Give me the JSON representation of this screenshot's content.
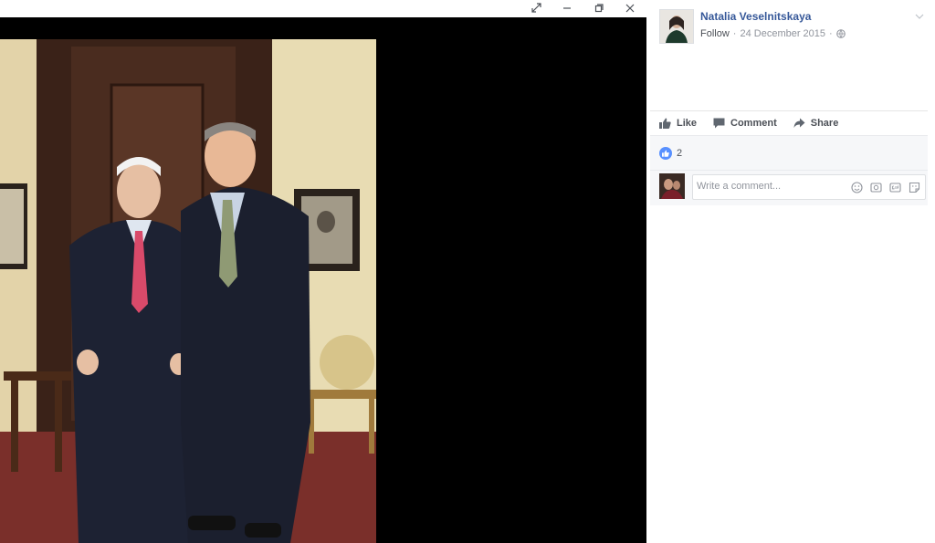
{
  "window": {
    "controls": [
      "expand-icon",
      "minimize-icon",
      "restore-icon",
      "close-icon"
    ]
  },
  "post": {
    "author": "Natalia Veselnitskaya",
    "follow_label": "Follow",
    "separator": "·",
    "date": "24 December 2015",
    "privacy_icon": "globe-icon"
  },
  "actions": {
    "like": "Like",
    "comment": "Comment",
    "share": "Share"
  },
  "reactions": {
    "icon": "thumbs-up-icon",
    "count": "2"
  },
  "comment_box": {
    "placeholder": "Write a comment...",
    "icons": [
      "emoji-icon",
      "camera-icon",
      "gif-icon",
      "sticker-icon"
    ]
  },
  "colors": {
    "link": "#365899",
    "muted": "#90949c",
    "like_blue": "#5890ff",
    "viewer_bg": "#000000"
  }
}
